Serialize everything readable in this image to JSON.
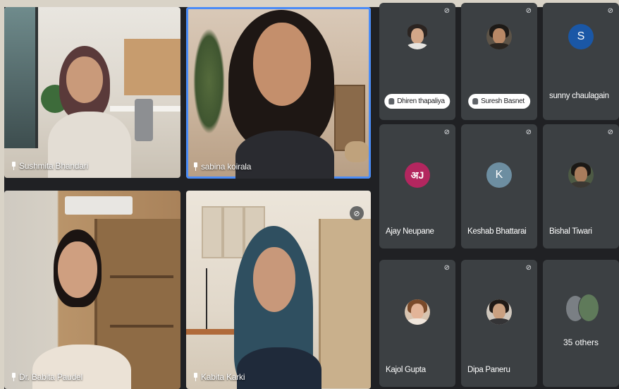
{
  "colors": {
    "meet_background": "#202124",
    "tile_background": "#3c4043",
    "active_speaker_border": "#4a8cf7",
    "outer_border": "#d9d3c7"
  },
  "video_tiles": [
    {
      "name": "Sushmita Bhandari",
      "pinned": true
    },
    {
      "name": "sabina koirala",
      "pinned": true,
      "active_speaker": true
    },
    {
      "name": "Dr. Babita Paudel",
      "pinned": true
    },
    {
      "name": "Kabita Karki",
      "pinned": true,
      "muted": true
    }
  ],
  "participants": [
    {
      "name": "Dhiren thapaliya",
      "avatar": "photo",
      "hand_raised": true,
      "mic_icon": "mic-off-icon"
    },
    {
      "name": "Suresh Basnet",
      "avatar": "photo",
      "hand_raised": true,
      "mic_icon": "mic-off-icon"
    },
    {
      "name": "sunny chaulagain",
      "avatar": "letter",
      "initial": "S",
      "avatar_color": "#1a57a6",
      "mic_icon": "mic-off-icon"
    },
    {
      "name": "Ajay Neupane",
      "avatar": "logo",
      "initial": "अJ",
      "avatar_color": "#b3265f",
      "mic_icon": "mic-off-icon"
    },
    {
      "name": "Keshab Bhattarai",
      "avatar": "letter",
      "initial": "K",
      "avatar_color": "#6d8ea1",
      "mic_icon": "mic-off-icon"
    },
    {
      "name": "Bishal Tiwari",
      "avatar": "photo",
      "mic_icon": "mic-off-icon"
    },
    {
      "name": "Kajol Gupta",
      "avatar": "photo",
      "mic_icon": "mic-off-icon"
    },
    {
      "name": "Dipa Paneru",
      "avatar": "photo",
      "mic_icon": "mic-off-icon"
    },
    {
      "name": "35 others",
      "avatar": "group"
    }
  ]
}
